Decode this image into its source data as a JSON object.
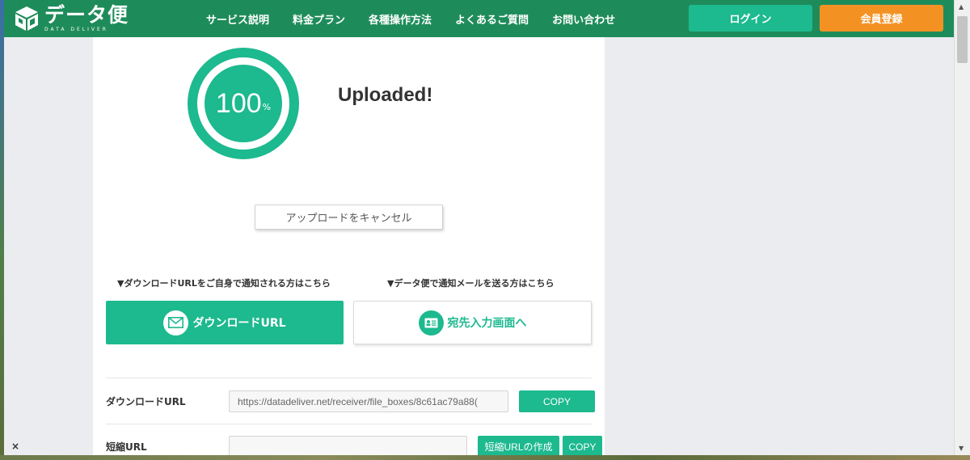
{
  "header": {
    "logo_text": "データ便",
    "logo_subtext": "DATA DELIVER",
    "nav": [
      "サービス説明",
      "料金プラン",
      "各種操作方法",
      "よくあるご質問",
      "お問い合わせ"
    ],
    "login_label": "ログイン",
    "register_label": "会員登録"
  },
  "upload": {
    "progress_percent": 100,
    "progress_value": "100",
    "progress_unit": "%",
    "status": "Uploaded!",
    "cancel_label": "アップロードをキャンセル"
  },
  "options": {
    "left_hint": "▼ダウンロードURLをご自身で通知される方はこちら",
    "right_hint": "▼データ便で通知メールを送る方はこちら",
    "download_url_button": "ダウンロードURL",
    "recipient_button": "宛先入力画面へ"
  },
  "urls": {
    "download_label": "ダウンロードURL",
    "download_value": "https://datadeliver.net/receiver/file_boxes/8c61ac79a88(",
    "copy_label": "COPY",
    "short_label": "短縮URL",
    "short_value": "",
    "create_short_label": "短縮URLの作成",
    "short_copy_label": "COPY"
  },
  "colors": {
    "header_green": "#1e8c5a",
    "accent_green": "#1db98f",
    "register_orange": "#f39223"
  },
  "icons": {
    "logo": "cube-logo-icon",
    "download": "mail-icon",
    "recipient": "id-card-icon"
  }
}
